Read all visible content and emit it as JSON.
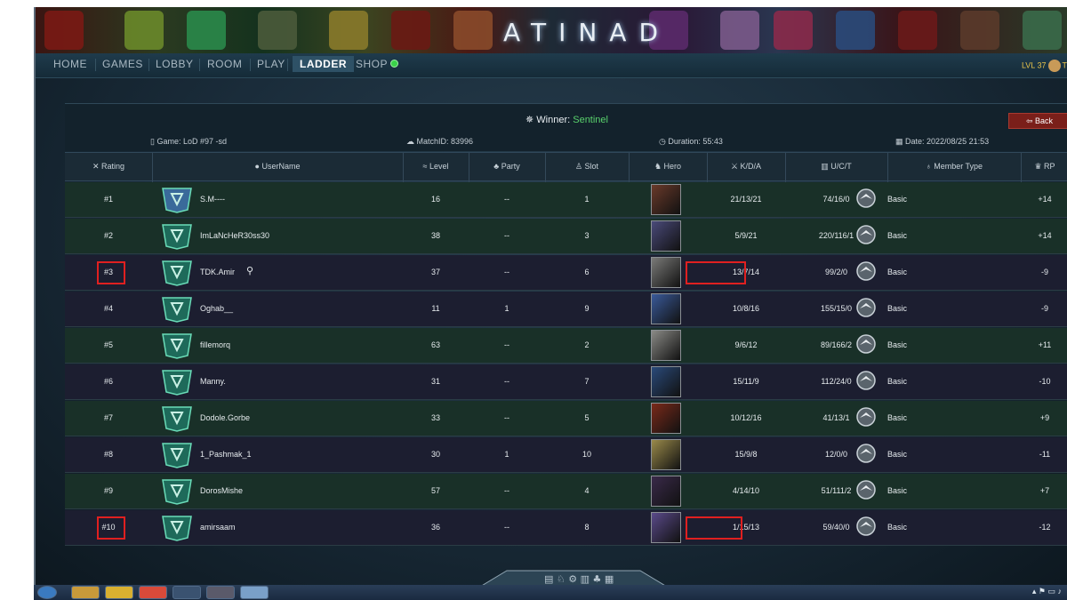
{
  "brand": "ATINAD",
  "nav": {
    "items": [
      "HOME",
      "GAMES",
      "LOBBY",
      "ROOM",
      "PLAY",
      "LADDER",
      "SHOP"
    ],
    "active": "LADDER",
    "level_text": "LVL 37",
    "user_text": "T"
  },
  "match": {
    "winner_label": "Winner:",
    "winner_team": "Sentinel",
    "game": "Game: LoD #97 -sd",
    "match_id": "MatchID: 83996",
    "duration": "Duration: 55:43",
    "date": "Date: 2022/08/25 21:53",
    "back_label": "Back"
  },
  "columns": [
    "Rating",
    "UserName",
    "Level",
    "Party",
    "Slot",
    "Hero",
    "K/D/A",
    "U/C/T",
    "Member Type",
    "RP"
  ],
  "rows": [
    {
      "rating": "#1",
      "username": "S.M----",
      "level": "16",
      "party": "--",
      "slot": "1",
      "kda": "21/13/21",
      "uct": "74/16/0",
      "member_type": "Basic",
      "rp": "+14",
      "team": "green",
      "hero_color": "#6a3a2a"
    },
    {
      "rating": "#2",
      "username": "ImLaNcHeR30ss30",
      "level": "38",
      "party": "--",
      "slot": "3",
      "kda": "5/9/21",
      "uct": "220/116/1",
      "member_type": "Basic",
      "rp": "+14",
      "team": "green",
      "hero_color": "#4a4a7a"
    },
    {
      "rating": "#3",
      "username": "TDK.Amir",
      "level": "37",
      "party": "--",
      "slot": "6",
      "kda": "13/7/14",
      "uct": "99/2/0",
      "member_type": "Basic",
      "rp": "-9",
      "team": "dark",
      "hero_color": "#7a7a78"
    },
    {
      "rating": "#4",
      "username": "Oghab__",
      "level": "11",
      "party": "1",
      "slot": "9",
      "kda": "10/8/16",
      "uct": "155/15/0",
      "member_type": "Basic",
      "rp": "-9",
      "team": "dark",
      "hero_color": "#3a5a9a"
    },
    {
      "rating": "#5",
      "username": "fillemorq",
      "level": "63",
      "party": "--",
      "slot": "2",
      "kda": "9/6/12",
      "uct": "89/166/2",
      "member_type": "Basic",
      "rp": "+11",
      "team": "green",
      "hero_color": "#8a8a86"
    },
    {
      "rating": "#6",
      "username": "Manny.",
      "level": "31",
      "party": "--",
      "slot": "7",
      "kda": "15/11/9",
      "uct": "112/24/0",
      "member_type": "Basic",
      "rp": "-10",
      "team": "dark",
      "hero_color": "#2a4a7a"
    },
    {
      "rating": "#7",
      "username": "Dodole.Gorbe",
      "level": "33",
      "party": "--",
      "slot": "5",
      "kda": "10/12/16",
      "uct": "41/13/1",
      "member_type": "Basic",
      "rp": "+9",
      "team": "green",
      "hero_color": "#7a2a1a"
    },
    {
      "rating": "#8",
      "username": "1_Pashmak_1",
      "level": "30",
      "party": "1",
      "slot": "10",
      "kda": "15/9/8",
      "uct": "12/0/0",
      "member_type": "Basic",
      "rp": "-11",
      "team": "dark",
      "hero_color": "#9a8a4a"
    },
    {
      "rating": "#9",
      "username": "DorosMishe",
      "level": "57",
      "party": "--",
      "slot": "4",
      "kda": "4/14/10",
      "uct": "51/111/2",
      "member_type": "Basic",
      "rp": "+7",
      "team": "green",
      "hero_color": "#3a2a4a"
    },
    {
      "rating": "#10",
      "username": "amirsaam",
      "level": "36",
      "party": "--",
      "slot": "8",
      "kda": "1/15/13",
      "uct": "59/40/0",
      "member_type": "Basic",
      "rp": "-12",
      "team": "dark",
      "hero_color": "#5a4a8a"
    }
  ],
  "colors": {
    "winner": "#59d16c",
    "highlight": "#e02020",
    "back": "#7a1f1a"
  }
}
